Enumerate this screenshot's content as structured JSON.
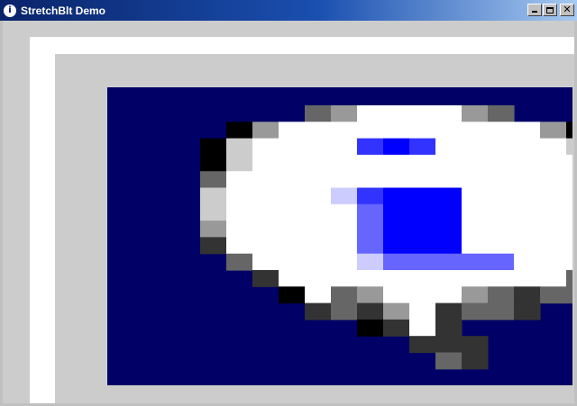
{
  "window": {
    "title": "StretchBlt Demo",
    "icon": "info-icon",
    "controls": {
      "minimize_icon": "minimize-icon",
      "maximize_icon": "maximize-icon",
      "close_icon": "close-icon"
    }
  },
  "colors": {
    "titlebar_start": "#0a246a",
    "titlebar_end": "#a6caf0",
    "client_background": "#cccccc",
    "canvas_background": "#000066"
  },
  "bitmap": {
    "description_icon": "stretched-information-icon",
    "palette": {
      ".": null,
      "W": "#ffffff",
      "l": "#cccccc",
      "s": "#999999",
      "m": "#666666",
      "d": "#333333",
      "k": "#000000",
      "B": "#0000ff",
      "b": "#3333ff",
      "v": "#6666ff",
      "p": "#ccccff"
    },
    "rows": [
      "......msWWWWsm......",
      "...ksWWWWWWWWWWsk...",
      "..klWWWWbBbWWWWWlk..",
      "..klWWWWWWWWWWWWWsk.",
      "..mWWWWWWWWWWWWWWWdk",
      "..lWWWWpbBBBWWWWWWmm",
      "..lWWWWWvBBBWWWWWWmm",
      "..sWWWWWvBBBWWWWWWmm",
      "..dWWWWWvBBBWWWWWWdm",
      "...mWWWWpvvvvvWWWmmd",
      "....dWWWWWWWWWWWmmm.",
      ".....kWmsWWWsmdmm...",
      "......dmdsWdmmd.....",
      "........kdWd........",
      "..........ddd.......",
      "...........md......."
    ]
  }
}
